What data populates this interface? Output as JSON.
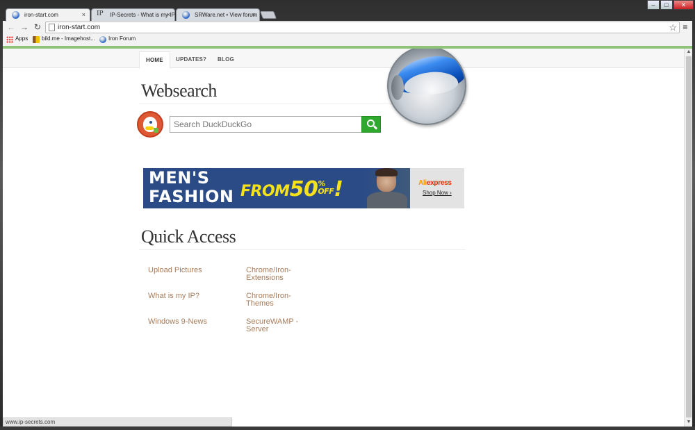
{
  "browser": {
    "tabs": [
      {
        "title": "iron-start.com",
        "close": "×",
        "active": true
      },
      {
        "title": "IP-Secrets - What is my IP",
        "close": "×",
        "icon_text": "IP",
        "active": false
      },
      {
        "title": "SRWare.net • View forum",
        "close": "×",
        "active": false
      }
    ],
    "window_controls": {
      "minimize": "–",
      "maximize": "□",
      "close": "✕"
    },
    "nav": {
      "back": "←",
      "forward": "→",
      "reload": "↻",
      "menu": "≡"
    },
    "url": "iron-start.com",
    "star": "☆",
    "bookmarks": [
      {
        "label": "Apps"
      },
      {
        "label": "bild.me - Imagehost..."
      },
      {
        "label": "Iron Forum"
      }
    ],
    "accent_color": "#8fc37a",
    "status_text": "www.ip-secrets.com",
    "scrollbar": {
      "up": "▲",
      "down": "▼"
    }
  },
  "page": {
    "nav_links": [
      {
        "label": "HOME",
        "active": true
      },
      {
        "label": "UPDATES?"
      },
      {
        "label": "BLOG"
      }
    ],
    "websearch_title": "Websearch",
    "search_placeholder": "Search DuckDuckGo",
    "ad": {
      "line1": "MEN'S",
      "line2": "FASHION",
      "from": "FROM",
      "percent": "50",
      "percent_sign": "%",
      "off": "OFF",
      "bang": "!",
      "brand_ali": "Ali",
      "brand_express": "express",
      "cta": "Shop Now ›",
      "background_color": "#2a4b86",
      "accent_color": "#f7e21a"
    },
    "quick_access_title": "Quick Access",
    "quick_links": [
      {
        "label": "Upload Pictures"
      },
      {
        "label": "What is my IP?"
      },
      {
        "label": "Windows 9-News"
      },
      {
        "label": "Chrome/Iron-Extensions"
      },
      {
        "label": "Chrome/Iron-Themes"
      },
      {
        "label": "SecureWAMP - Server"
      }
    ],
    "link_color": "#a87a58",
    "search_button_color": "#2fa82f"
  }
}
